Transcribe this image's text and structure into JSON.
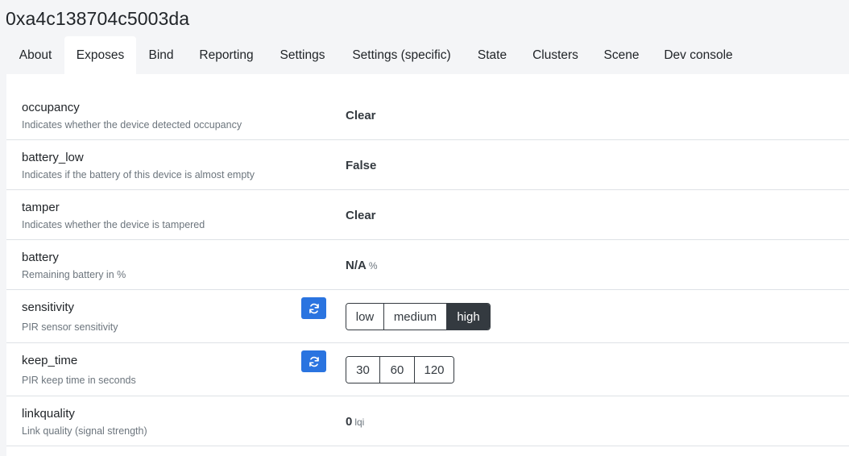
{
  "device": {
    "title": "0xa4c138704c5003da"
  },
  "tabs": [
    {
      "label": "About"
    },
    {
      "label": "Exposes"
    },
    {
      "label": "Bind"
    },
    {
      "label": "Reporting"
    },
    {
      "label": "Settings"
    },
    {
      "label": "Settings (specific)"
    },
    {
      "label": "State"
    },
    {
      "label": "Clusters"
    },
    {
      "label": "Scene"
    },
    {
      "label": "Dev console"
    }
  ],
  "active_tab": "Exposes",
  "exposes": {
    "occupancy": {
      "name": "occupancy",
      "description": "Indicates whether the device detected occupancy",
      "value": "Clear"
    },
    "battery_low": {
      "name": "battery_low",
      "description": "Indicates if the battery of this device is almost empty",
      "value": "False"
    },
    "tamper": {
      "name": "tamper",
      "description": "Indicates whether the device is tampered",
      "value": "Clear"
    },
    "battery": {
      "name": "battery",
      "description": "Remaining battery in %",
      "value": "N/A",
      "unit": "%"
    },
    "sensitivity": {
      "name": "sensitivity",
      "description": "PIR sensor sensitivity",
      "options": [
        "low",
        "medium",
        "high"
      ],
      "selected": "high"
    },
    "keep_time": {
      "name": "keep_time",
      "description": "PIR keep time in seconds",
      "options": [
        "30",
        "60",
        "120"
      ],
      "selected": ""
    },
    "linkquality": {
      "name": "linkquality",
      "description": "Link quality (signal strength)",
      "value": "0",
      "unit": "lqi"
    }
  },
  "icons": {
    "refresh": "refresh-icon"
  },
  "colors": {
    "refresh_button": "#2a74e0",
    "selected_option": "#343a40"
  }
}
